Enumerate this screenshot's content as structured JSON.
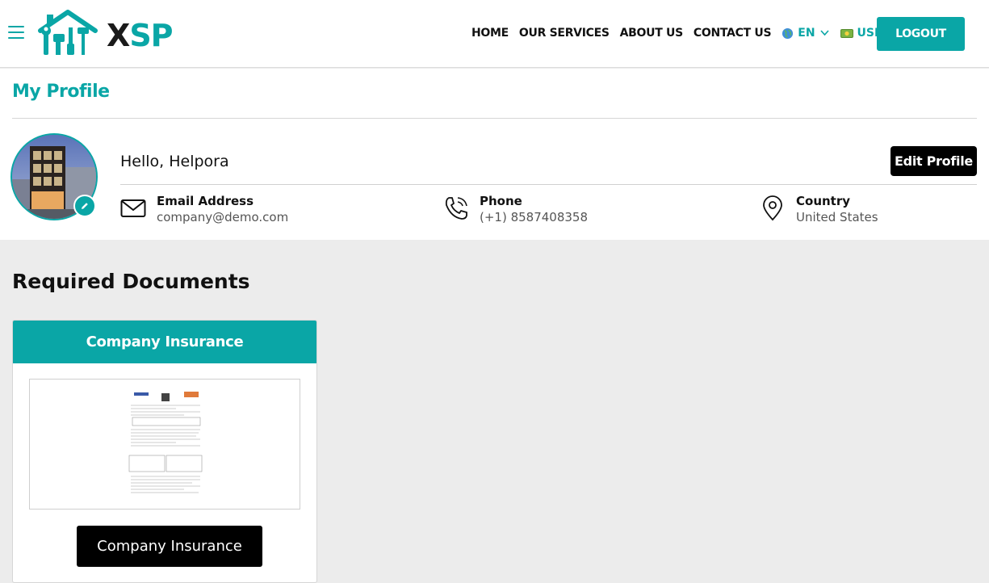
{
  "brand": {
    "logo_x": "X",
    "logo_sp": "SP"
  },
  "nav": {
    "links": [
      "HOME",
      "OUR SERVICES",
      "ABOUT US",
      "CONTACT US"
    ],
    "language": "EN",
    "currency": "USD",
    "logout_label": "LOGOUT"
  },
  "profile": {
    "page_title": "My Profile",
    "greeting": "Hello, Helpora",
    "edit_label": "Edit Profile",
    "email_label": "Email Address",
    "email_value": "company@demo.com",
    "phone_label": "Phone",
    "phone_value": "(+1) 8587408358",
    "country_label": "Country",
    "country_value": "United States"
  },
  "documents": {
    "section_title": "Required Documents",
    "cards": [
      {
        "header": "Company Insurance",
        "button_label": "Company Insurance"
      }
    ]
  },
  "colors": {
    "accent": "#0aa6a6",
    "dark": "#000000",
    "page_bg": "#ececec"
  }
}
